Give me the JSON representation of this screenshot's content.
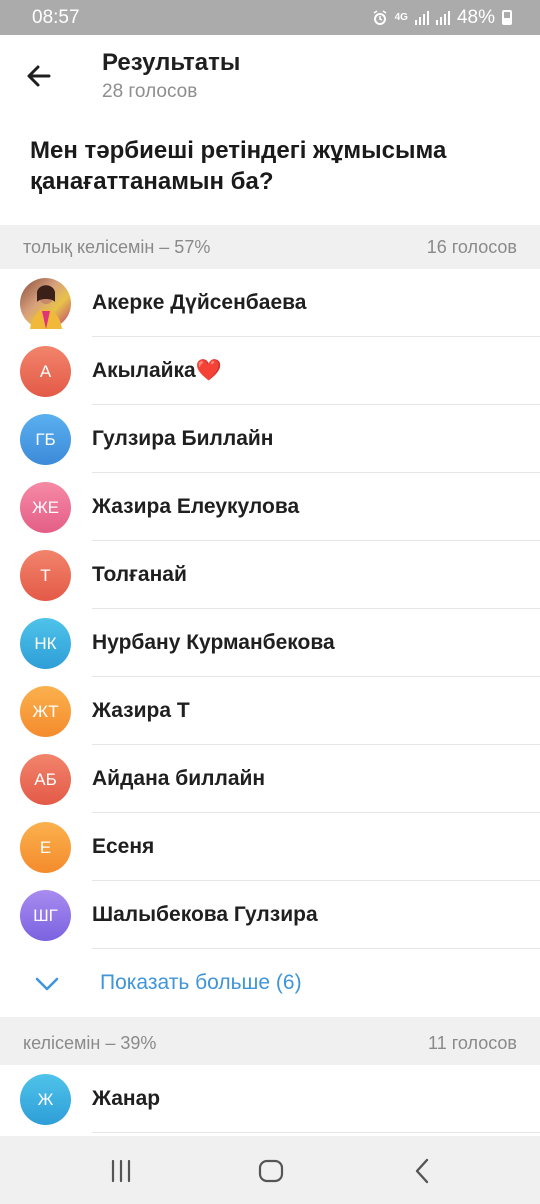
{
  "status": {
    "time": "08:57",
    "network": "4G",
    "battery": "48%"
  },
  "header": {
    "title": "Результаты",
    "subtitle": "28 голосов"
  },
  "question": "Мен тәрбиеші ретіндегі жұмысыма қанағаттанамын ба?",
  "sections": [
    {
      "label": "толық келісемін – 57%",
      "votes": "16 голосов",
      "voters": [
        {
          "name": "Акерке Дүйсенбаева",
          "initials": "",
          "photo": true
        },
        {
          "name": "Акылайка❤️",
          "initials": "А",
          "color": "#e8604e"
        },
        {
          "name": "Гулзира Биллайн",
          "initials": "ГБ",
          "color": "#4a9de6"
        },
        {
          "name": "Жазира Елеукулова",
          "initials": "ЖЕ",
          "color": "#ee6f96"
        },
        {
          "name": "Толғанай",
          "initials": "Т",
          "color": "#e8604e"
        },
        {
          "name": "Нурбану Курманбекова",
          "initials": "НК",
          "color": "#3fb1e2"
        },
        {
          "name": "Жазира Т",
          "initials": "ЖТ",
          "color": "#f79d3c"
        },
        {
          "name": "Айдана биллайн",
          "initials": "АБ",
          "color": "#e8604e"
        },
        {
          "name": "Есеня",
          "initials": "Е",
          "color": "#f79d3c"
        },
        {
          "name": "Шалыбекова Гулзира",
          "initials": "ШГ",
          "color": "#8f75e8"
        }
      ],
      "show_more": "Показать больше (6)"
    },
    {
      "label": "келісемін – 39%",
      "votes": "11 голосов",
      "voters": [
        {
          "name": "Жанар",
          "initials": "Ж",
          "color": "#3fb1e2"
        }
      ]
    }
  ],
  "icons": {
    "back": "arrow-left-icon",
    "expand": "chevron-down-icon",
    "nav_recents": "recents-icon",
    "nav_home": "home-icon",
    "nav_back": "back-icon"
  },
  "colors": {
    "accent": "#3f95d9",
    "background": "#f0f0f0"
  }
}
